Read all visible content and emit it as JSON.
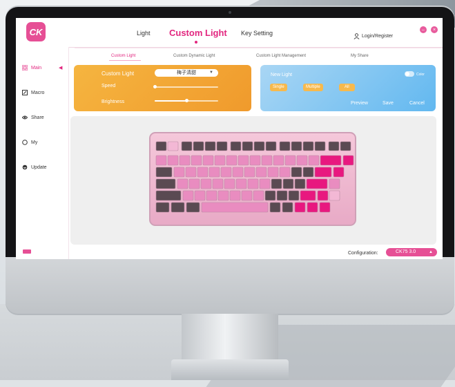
{
  "app": {
    "logo_text": "CK",
    "nav": [
      {
        "label": "Light",
        "active": false
      },
      {
        "label": "Custom Light",
        "active": true
      },
      {
        "label": "Key Setting",
        "active": false
      }
    ],
    "login_label": "Login/Register"
  },
  "subnav": [
    {
      "label": "Custom Light",
      "active": true
    },
    {
      "label": "Custom Dynamic Light",
      "active": false
    },
    {
      "label": "Custom Light Management",
      "active": false
    },
    {
      "label": "My Share",
      "active": false
    }
  ],
  "sidebar": {
    "items": [
      {
        "label": "Main",
        "icon": "grid-icon",
        "active": true
      },
      {
        "label": "Macro",
        "icon": "macro-icon",
        "active": false
      },
      {
        "label": "Share",
        "icon": "share-icon",
        "active": false
      },
      {
        "label": "My",
        "icon": "user-icon",
        "active": false
      },
      {
        "label": "Update",
        "icon": "update-icon",
        "active": false
      }
    ]
  },
  "custom_light_panel": {
    "title": "Custom Light",
    "selected_preset": "梅子清甜",
    "speed_label": "Speed",
    "speed_level": 0.0,
    "brightness_label": "Brightness",
    "brightness_level": 0.5
  },
  "new_light_panel": {
    "title": "New Light",
    "toggle_label": "Color",
    "modes": [
      "Single",
      "Multiple",
      "All"
    ],
    "actions": [
      "Preview",
      "Save",
      "Cancel"
    ]
  },
  "footer": {
    "config_label": "Configuration:",
    "config_value": "CK75 3.0"
  },
  "colors": {
    "accent": "#e2267f",
    "orange_panel": "#f3a935",
    "blue_panel": "#7cc4f2",
    "key_dark": "#5a4a52",
    "key_pink": "#e98cc0",
    "key_magenta": "#e8187f"
  }
}
